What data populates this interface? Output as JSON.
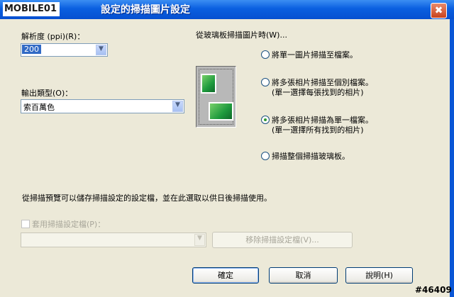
{
  "titlebar": {
    "watermark": "MOBILE01",
    "title": "設定的掃描圖片設定",
    "close_glyph": "✖"
  },
  "settings": {
    "resolution_label": "解析度 (ppi)(R)：",
    "resolution_value": "200",
    "output_type_label": "輸出類型(O)：",
    "output_type_value": "索百萬色"
  },
  "scan_options": {
    "heading": "從玻璃板掃描圖片時(W)...",
    "options": [
      {
        "line1": "將單一圖片掃描至檔案。",
        "line2": "",
        "selected": false
      },
      {
        "line1": "將多張相片掃描至個別檔案。",
        "line2": "(單一選擇每張找到的相片)",
        "selected": false
      },
      {
        "line1": "將多張相片掃描為單一檔案。",
        "line2": "(單一選擇所有找到的相片)",
        "selected": true
      },
      {
        "line1": "掃描整個掃描玻璃板。",
        "line2": "",
        "selected": false
      }
    ]
  },
  "profile": {
    "info_text": "從掃描預覽可以儲存掃描設定的設定檔，並在此選取以供日後掃描使用。",
    "checkbox_label": "套用掃描設定檔(P)：",
    "select_value": "",
    "remove_button": "移除掃描設定檔(V)..."
  },
  "buttons": {
    "ok": "確定",
    "cancel": "取消",
    "help": "說明(H)"
  },
  "stamp": "#46409",
  "colors": {
    "titlebar": "#0a5fe0",
    "dialog_bg": "#ece9d8",
    "selection": "#316ac5"
  }
}
